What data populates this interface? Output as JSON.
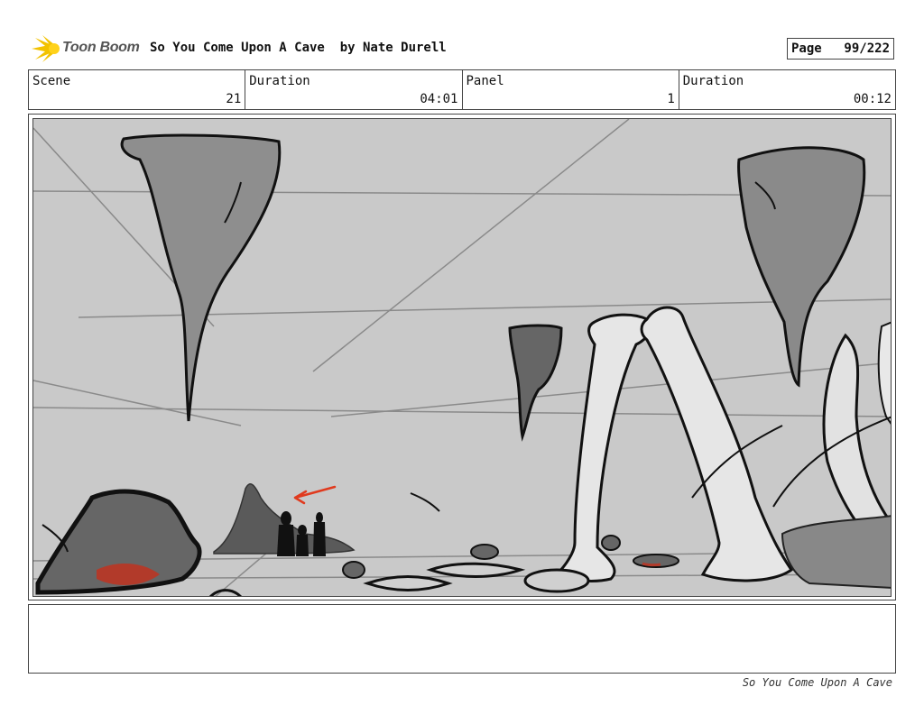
{
  "header": {
    "logo_text": "Toon Boom",
    "title": "So You Come Upon A Cave  by Nate Durell",
    "page_label": "Page",
    "page_value": "99/222"
  },
  "info": {
    "scene_label": "Scene",
    "scene_value": "21",
    "duration1_label": "Duration",
    "duration1_value": "04:01",
    "panel_label": "Panel",
    "panel_value": "1",
    "duration2_label": "Duration",
    "duration2_value": "00:12"
  },
  "footer": {
    "text": "So You Come Upon A Cave"
  }
}
